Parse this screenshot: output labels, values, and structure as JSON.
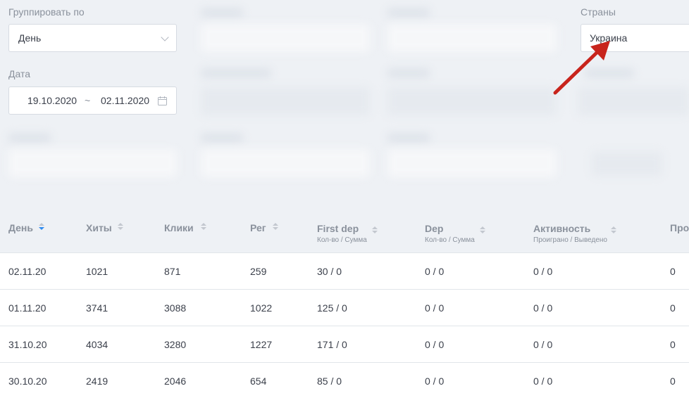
{
  "filters": {
    "group_by": {
      "label": "Группировать по",
      "value": "День"
    },
    "date": {
      "label": "Дата",
      "from": "19.10.2020",
      "separator": "~",
      "to": "02.11.2020"
    },
    "countries": {
      "label": "Страны",
      "value": "Украина"
    }
  },
  "table": {
    "columns": [
      {
        "label": "День",
        "sub": ""
      },
      {
        "label": "Хиты",
        "sub": ""
      },
      {
        "label": "Клики",
        "sub": ""
      },
      {
        "label": "Рег",
        "sub": ""
      },
      {
        "label": "First dep",
        "sub": "Кол-во / Сумма"
      },
      {
        "label": "Dep",
        "sub": "Кол-во / Сумма"
      },
      {
        "label": "Активность",
        "sub": "Проиграно / Выведено"
      },
      {
        "label": "Про",
        "sub": ""
      }
    ],
    "rows": [
      [
        "02.11.20",
        "1021",
        "871",
        "259",
        "30 / 0",
        "0 / 0",
        "0 / 0",
        "0"
      ],
      [
        "01.11.20",
        "3741",
        "3088",
        "1022",
        "125 / 0",
        "0 / 0",
        "0 / 0",
        "0"
      ],
      [
        "31.10.20",
        "4034",
        "3280",
        "1227",
        "171 / 0",
        "0 / 0",
        "0 / 0",
        "0"
      ],
      [
        "30.10.20",
        "2419",
        "2046",
        "654",
        "85 / 0",
        "0 / 0",
        "0 / 0",
        "0"
      ]
    ]
  },
  "colors": {
    "sort_active": "#2f8cf0",
    "arrow": "#c8241c"
  }
}
